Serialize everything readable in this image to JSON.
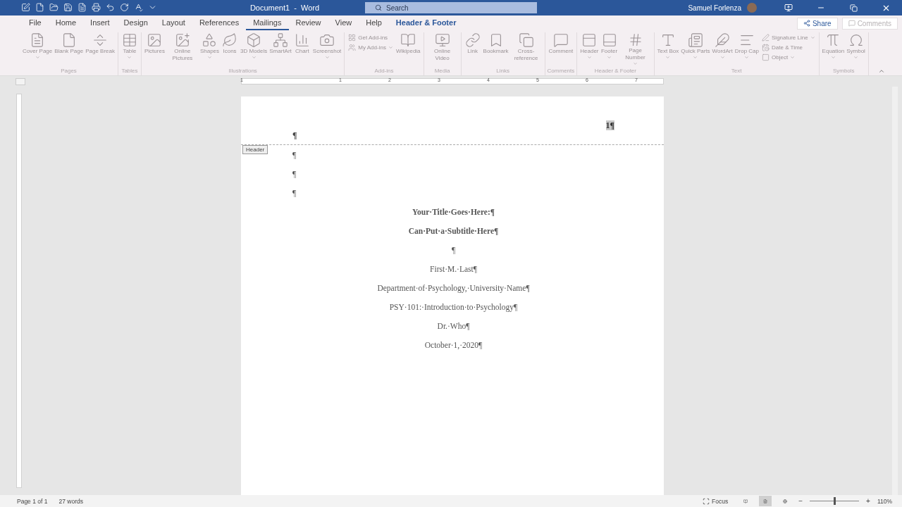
{
  "title_bar": {
    "title": "Document1  -  Word",
    "search": {
      "placeholder": "Search"
    },
    "user": "Samuel Forlenza"
  },
  "tabs": [
    {
      "label": "File",
      "selected": false,
      "contextual": false
    },
    {
      "label": "Home",
      "selected": false,
      "contextual": false
    },
    {
      "label": "Insert",
      "selected": false,
      "contextual": false
    },
    {
      "label": "Design",
      "selected": false,
      "contextual": false
    },
    {
      "label": "Layout",
      "selected": false,
      "contextual": false
    },
    {
      "label": "References",
      "selected": false,
      "contextual": false
    },
    {
      "label": "Mailings",
      "selected": true,
      "contextual": false
    },
    {
      "label": "Review",
      "selected": false,
      "contextual": false
    },
    {
      "label": "View",
      "selected": false,
      "contextual": false
    },
    {
      "label": "Help",
      "selected": false,
      "contextual": false
    },
    {
      "label": "Header & Footer",
      "selected": false,
      "contextual": true
    }
  ],
  "share": {
    "label": "Share"
  },
  "comments": {
    "label": "Comments",
    "disabled": true
  },
  "ribbon": {
    "groups": [
      {
        "label": "Pages",
        "items": [
          {
            "kind": "large",
            "label": "Cover Page",
            "menu": true
          },
          {
            "kind": "large",
            "label": "Blank Page",
            "menu": false
          },
          {
            "kind": "large",
            "label": "Page Break",
            "menu": false
          }
        ]
      },
      {
        "label": "Tables",
        "items": [
          {
            "kind": "large",
            "label": "Table",
            "menu": true
          }
        ]
      },
      {
        "label": "Illustrations",
        "items": [
          {
            "kind": "large",
            "label": "Pictures",
            "menu": false
          },
          {
            "kind": "large",
            "label": "Online Pictures",
            "menu": false
          },
          {
            "kind": "large",
            "label": "Shapes",
            "menu": true
          },
          {
            "kind": "large",
            "label": "Icons",
            "menu": false
          },
          {
            "kind": "large",
            "label": "3D Models",
            "menu": true
          },
          {
            "kind": "large",
            "label": "SmartArt",
            "menu": false
          },
          {
            "kind": "large",
            "label": "Chart",
            "menu": false
          },
          {
            "kind": "large",
            "label": "Screenshot",
            "menu": true
          }
        ]
      },
      {
        "label": "Add-ins",
        "items": [
          {
            "kind": "small",
            "label": "Get Add-ins",
            "menu": false
          },
          {
            "kind": "small",
            "label": "My Add-ins",
            "menu": true
          },
          {
            "kind": "large",
            "label": "Wikipedia",
            "menu": false
          }
        ]
      },
      {
        "label": "Media",
        "items": [
          {
            "kind": "large",
            "label": "Online Video",
            "menu": false
          }
        ]
      },
      {
        "label": "Links",
        "items": [
          {
            "kind": "large",
            "label": "Link",
            "menu": false
          },
          {
            "kind": "large",
            "label": "Bookmark",
            "menu": false
          },
          {
            "kind": "large",
            "label": "Cross-reference",
            "menu": false
          }
        ]
      },
      {
        "label": "Comments",
        "items": [
          {
            "kind": "large",
            "label": "Comment",
            "menu": false
          }
        ]
      },
      {
        "label": "Header & Footer",
        "items": [
          {
            "kind": "large",
            "label": "Header",
            "menu": true
          },
          {
            "kind": "large",
            "label": "Footer",
            "menu": true
          },
          {
            "kind": "large",
            "label": "Page Number",
            "menu": true
          }
        ]
      },
      {
        "label": "Text",
        "items": [
          {
            "kind": "large",
            "label": "Text Box",
            "menu": true
          },
          {
            "kind": "large",
            "label": "Quick Parts",
            "menu": true
          },
          {
            "kind": "large",
            "label": "WordArt",
            "menu": true
          },
          {
            "kind": "large",
            "label": "Drop Cap",
            "menu": true
          },
          {
            "kind": "small",
            "label": "Signature Line",
            "menu": true
          },
          {
            "kind": "small",
            "label": "Date & Time",
            "menu": false
          },
          {
            "kind": "small",
            "label": "Object",
            "menu": true
          }
        ]
      },
      {
        "label": "Symbols",
        "items": [
          {
            "kind": "large",
            "label": "Equation",
            "menu": true
          },
          {
            "kind": "large",
            "label": "Symbol",
            "menu": true
          }
        ]
      }
    ]
  },
  "ruler": {
    "labels": [
      "1",
      "1",
      "2",
      "3",
      "4",
      "5",
      "6",
      "7"
    ]
  },
  "document": {
    "header_tag": "Header",
    "header_mark": "¶",
    "page_number": "1¶",
    "paragraphs": [
      {
        "text": "¶",
        "kind": "mark",
        "bold": false
      },
      {
        "text": "¶",
        "kind": "mark",
        "bold": false
      },
      {
        "text": "¶",
        "kind": "mark",
        "bold": false
      },
      {
        "text": "Your·Title·Goes·Here:¶",
        "kind": "centered",
        "bold": true
      },
      {
        "text": "Can·Put·a·Subtitle·Here¶",
        "kind": "centered",
        "bold": true
      },
      {
        "text": "¶",
        "kind": "centered",
        "bold": false
      },
      {
        "text": "First·M.·Last¶",
        "kind": "centered",
        "bold": false
      },
      {
        "text": "Department·of·Psychology,·University·Name¶",
        "kind": "centered",
        "bold": false
      },
      {
        "text": "PSY·101:·Introduction·to·Psychology¶",
        "kind": "centered",
        "bold": false
      },
      {
        "text": "Dr.·Who¶",
        "kind": "centered",
        "bold": false
      },
      {
        "text": "October·1,·2020¶",
        "kind": "centered",
        "bold": false
      }
    ]
  },
  "status_bar": {
    "page": "Page 1 of 1",
    "words": "27 words",
    "focus": "Focus",
    "views": [
      {
        "selected": false
      },
      {
        "selected": true
      },
      {
        "selected": false
      }
    ],
    "zoom_out": "−",
    "zoom_in": "+",
    "zoom": {
      "level": 0.5,
      "reading": "110%"
    }
  }
}
